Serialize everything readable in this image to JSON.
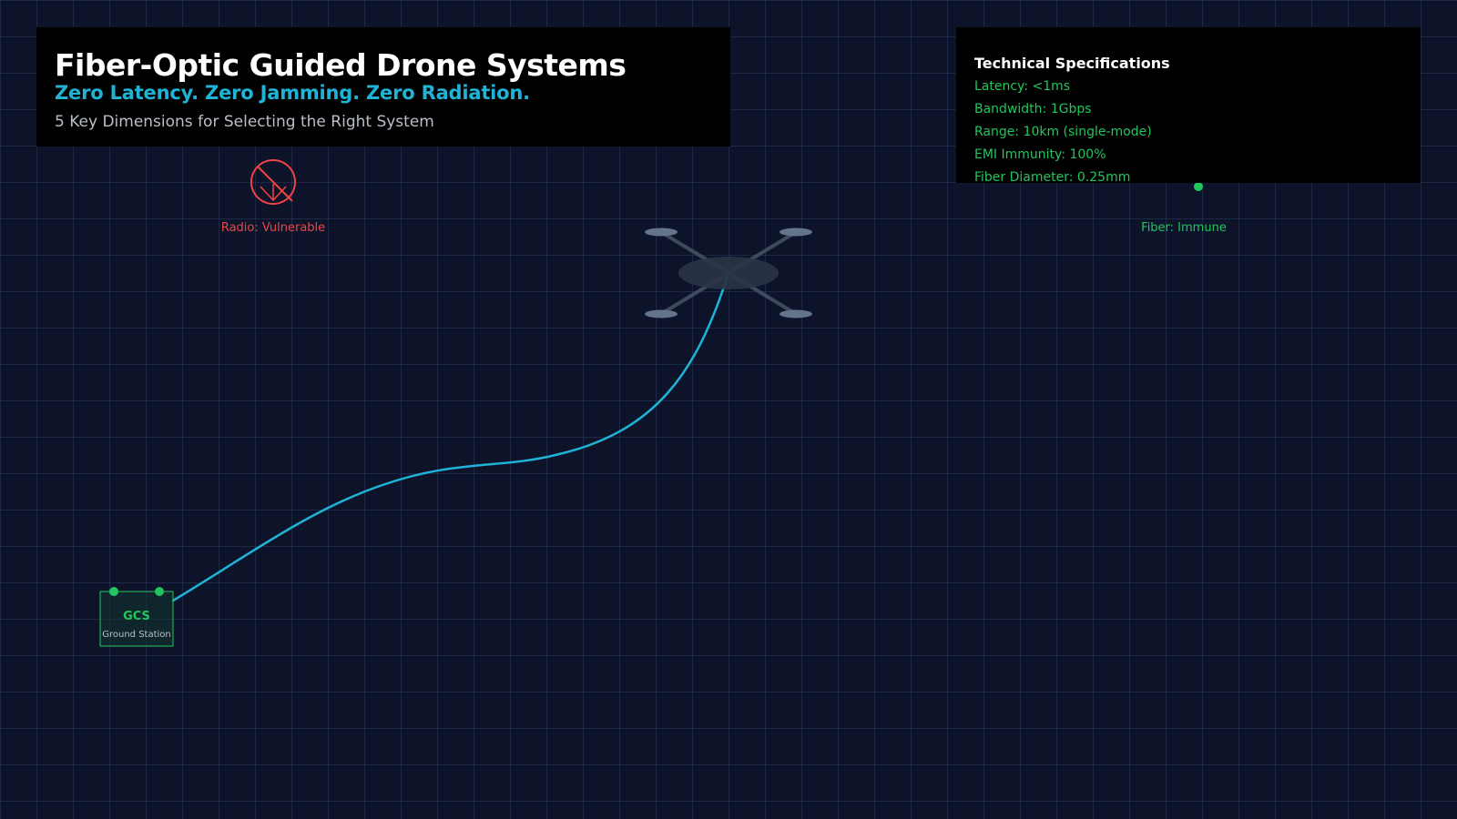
{
  "header": {
    "title": "Fiber-Optic Guided Drone Systems",
    "subtitle": "Zero Latency. Zero Jamming. Zero Radiation.",
    "tagline": "5 Key Dimensions for Selecting the Right System"
  },
  "specs": {
    "title": "Technical Specifications",
    "items": [
      "Latency: <1ms",
      "Bandwidth: 1Gbps",
      "Range: 10km (single-mode)",
      "EMI Immunity: 100%",
      "Fiber Diameter: 0.25mm"
    ]
  },
  "radio_label": "Radio: Vulnerable",
  "fiber_label": "Fiber: Immune",
  "gcs": {
    "label": "GCS",
    "sublabel": "Ground Station"
  },
  "colors": {
    "fiber": "#1fb3d6",
    "immune": "#22c55e",
    "vulnerable": "#ef4444",
    "drone_body": "#334155",
    "drone_prop": "#64748b"
  },
  "icons": {
    "radio": "no-signal-icon",
    "fiber": "status-dot-icon",
    "drone": "quadcopter-icon"
  }
}
